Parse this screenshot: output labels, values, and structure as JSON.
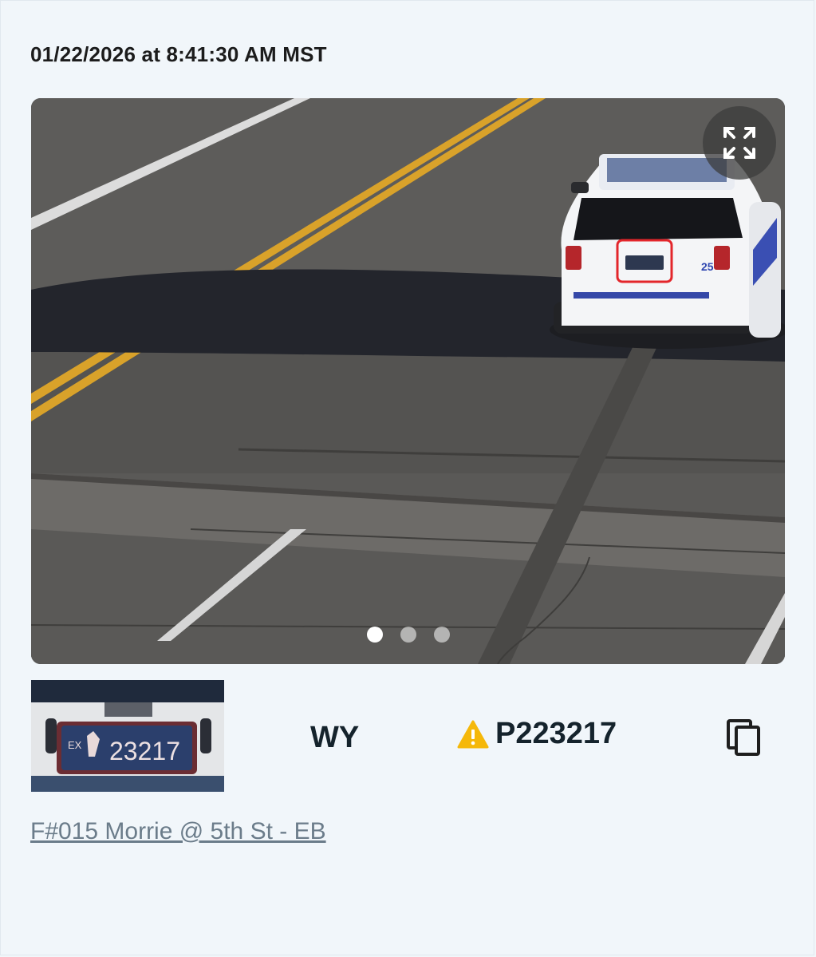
{
  "capture": {
    "timestamp": "01/22/2026 at 8:41:30 AM MST",
    "image_count": 3,
    "active_image": 1
  },
  "icons": {
    "expand": "expand-arrows-icon",
    "warning": "warning-triangle-icon",
    "copy": "copy-icon"
  },
  "plate": {
    "crop_prefix": "EX",
    "crop_number": "23217",
    "state": "WY",
    "read_value": "P223217"
  },
  "vehicle": {
    "unit_number": "25"
  },
  "location": {
    "label": "F#015 Morrie @ 5th St - EB"
  },
  "colors": {
    "warning": "#f5b80a",
    "detection_box": "#e3262b",
    "link": "#6b7c8a"
  }
}
